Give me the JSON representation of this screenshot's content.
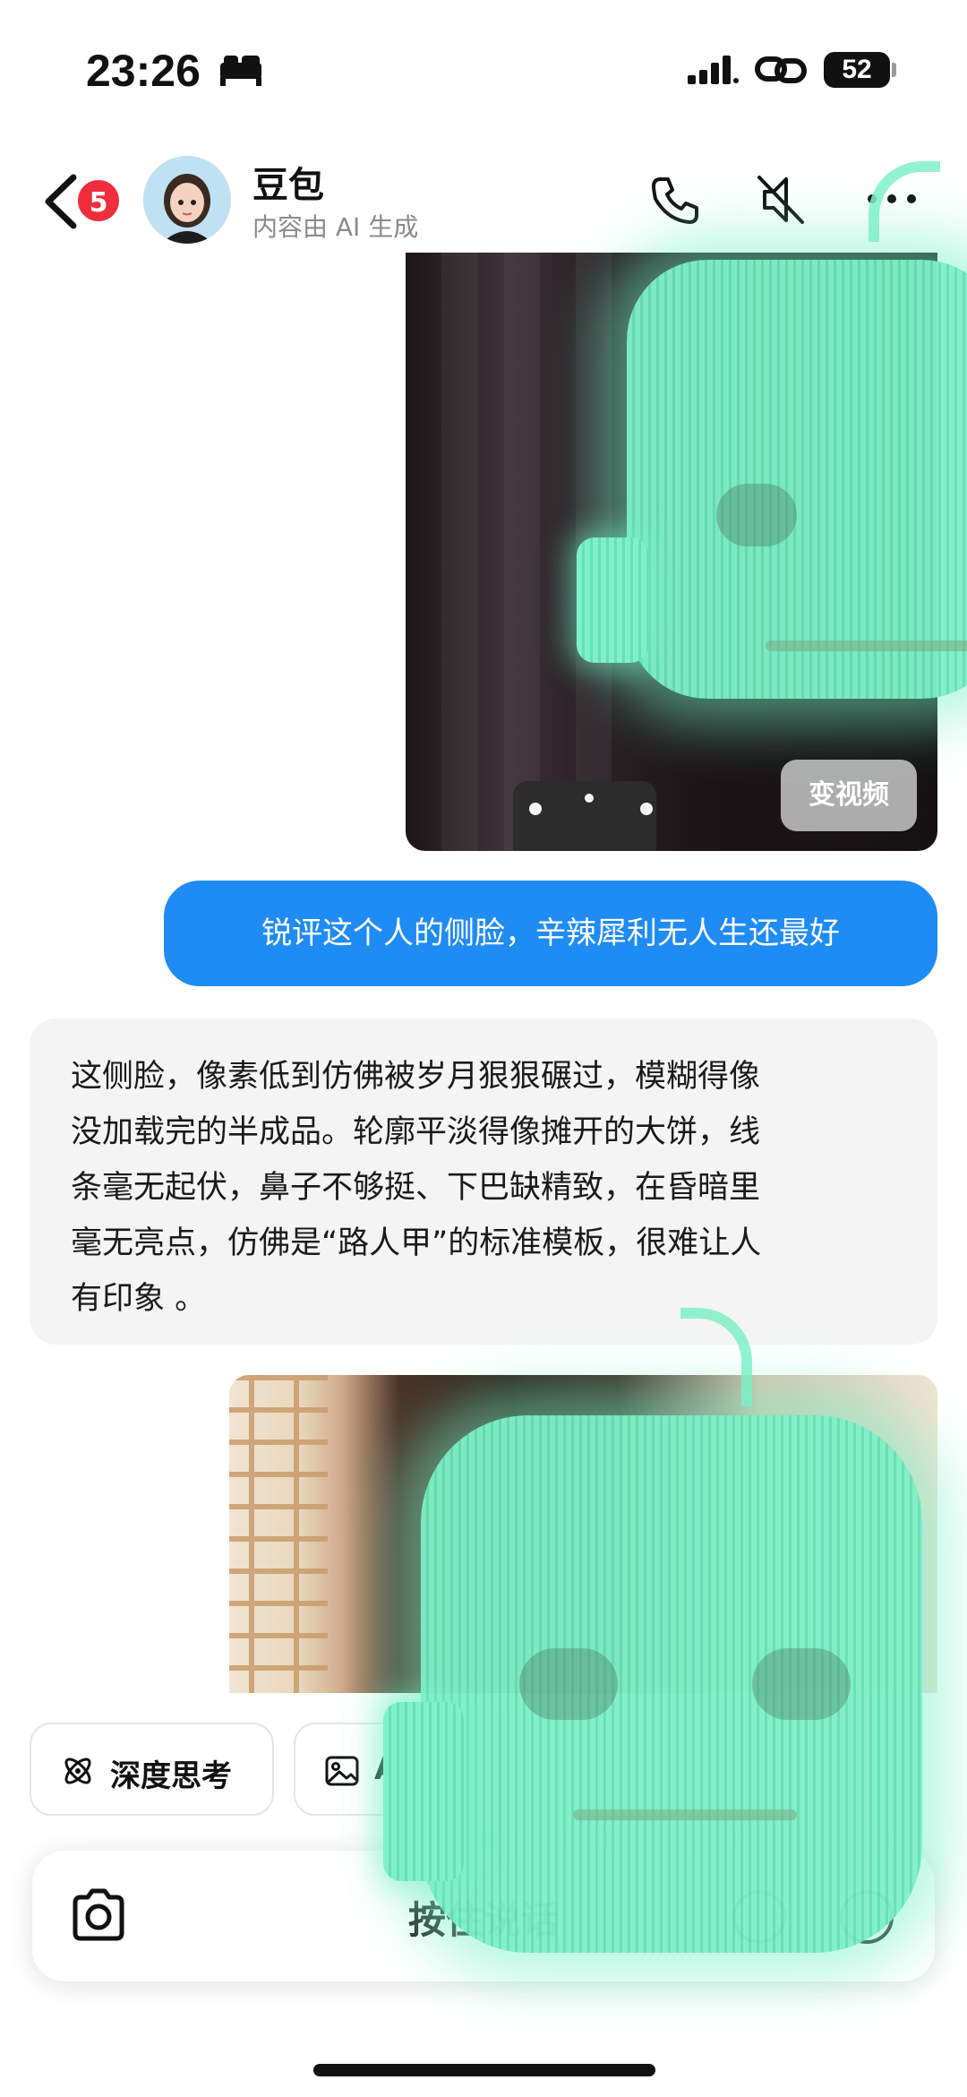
{
  "status_bar": {
    "time": "23:26",
    "battery": "52"
  },
  "header": {
    "back_badge": "5",
    "contact_name": "豆包",
    "contact_subtitle": "内容由 AI 生成"
  },
  "messages": {
    "image_1": {
      "to_video_label": "变视频"
    },
    "user_text": "锐评这个人的侧脸，辛辣犀利无人生还最好",
    "ai_reply_lines": [
      "这侧脸，像素低到仿佛被岁月狠狠碾过，模糊得像",
      "没加载完的半成品。轮廓平淡得像摊开的大饼，线",
      "条毫无起伏，鼻子不够挺、下巴缺精致，在昏暗里",
      "毫无亮点，仿佛是“路人甲”的标准模板，很难让人",
      "有印象 。"
    ]
  },
  "chips": {
    "deep_think": "深度思考",
    "image_partial": "A"
  },
  "input_bar": {
    "hold_to_talk": "按住说话"
  },
  "colors": {
    "user_bubble": "#1f8bf5",
    "ai_bubble": "#f4f4f5",
    "badge": "#f02d3c",
    "robot_overlay": "#7ff0c8"
  },
  "icons": [
    "bed-icon",
    "signal-icon",
    "link-icon",
    "back-arrow-icon",
    "phone-call-icon",
    "mute-icon",
    "more-icon",
    "atom-icon",
    "image-icon",
    "camera-icon"
  ]
}
